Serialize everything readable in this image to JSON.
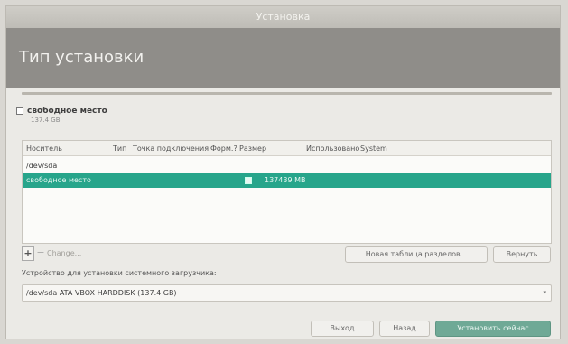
{
  "window": {
    "title": "Установка",
    "header_title": "Тип установки"
  },
  "legend": {
    "label": "свободное место",
    "size": "137.4 GB",
    "swatch_color": "#ffffff"
  },
  "table": {
    "columns": [
      "Носитель",
      "Тип",
      "Точка подключения",
      "Форм.?",
      "Размер",
      "Использовано",
      "System"
    ],
    "rows": [
      {
        "device": "/dev/sda"
      },
      {
        "device": "свободное место",
        "size": "137439 MB",
        "selected": true
      }
    ],
    "accent_color": "#27a58b"
  },
  "toolbar": {
    "add_label": "+",
    "remove_label": "−",
    "change_label": "Change...",
    "new_table_label": "Новая таблица разделов...",
    "revert_label": "Вернуть"
  },
  "bootloader": {
    "label": "Устройство для установки системного загрузчика:",
    "value": "/dev/sda ATA VBOX HARDDISK (137.4 GB)"
  },
  "footer": {
    "quit_label": "Выход",
    "back_label": "Назад",
    "install_label": "Установить сейчас"
  }
}
